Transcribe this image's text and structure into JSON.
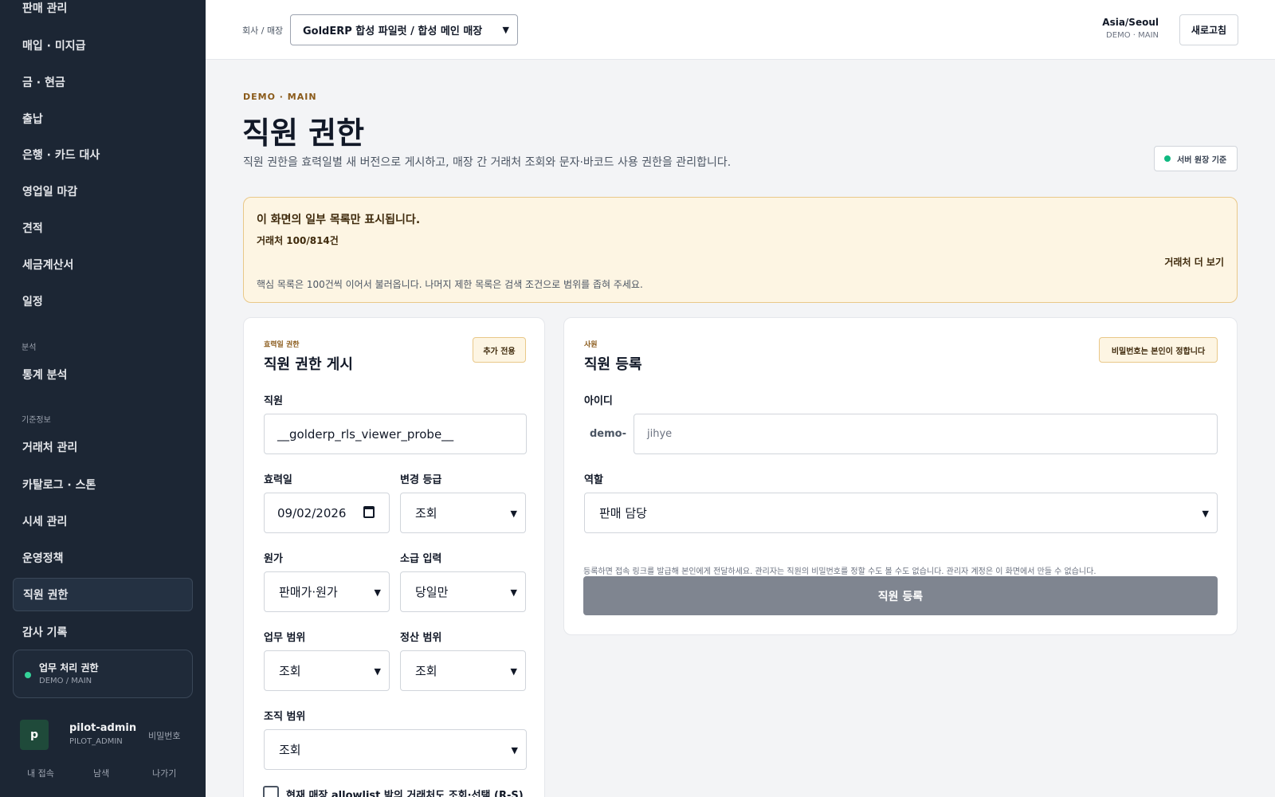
{
  "sidebar": {
    "items": [
      {
        "label": "판매 관리"
      },
      {
        "label": "매입 · 미지급"
      },
      {
        "label": "금 · 현금"
      },
      {
        "label": "출납"
      },
      {
        "label": "은행 · 카드 대사"
      },
      {
        "label": "영업일 마감"
      },
      {
        "label": "견적"
      },
      {
        "label": "세금계산서"
      },
      {
        "label": "일정"
      },
      {
        "label": "통계 분석"
      },
      {
        "label": "거래처 관리"
      },
      {
        "label": "카탈로그 · 스톤"
      },
      {
        "label": "시세 관리"
      },
      {
        "label": "운영정책"
      },
      {
        "label": "직원 권한"
      },
      {
        "label": "감사 기록"
      }
    ],
    "sections": {
      "analysis": "분석",
      "master": "기준정보"
    },
    "permission_card": {
      "title": "업무 처리 권한",
      "sub": "DEMO / MAIN"
    },
    "user": {
      "initial": "p",
      "name": "pilot-admin",
      "role": "PILOT_ADMIN",
      "password_link": "비밀번호"
    },
    "footer": {
      "my_access": "내 접속",
      "theme": "남색",
      "logout": "나가기"
    }
  },
  "header": {
    "company_label": "회사 / 매장",
    "company_value": "GoldERP 합성 파일럿 / 합성 메인 매장",
    "timezone": "Asia/Seoul",
    "tenant": "DEMO · MAIN",
    "refresh": "새로고침"
  },
  "page": {
    "eyebrow": "DEMO · MAIN",
    "title": "직원 권한",
    "description": "직원 권한을 효력일별 새 버전으로 게시하고, 매장 간 거래처 조회와 문자·바코드 사용 권한을 관리합니다.",
    "policy_badge": "서버 원장 기준"
  },
  "notice": {
    "title": "이 화면의 일부 목록만 표시됩니다.",
    "count": "거래처 100/814건",
    "more": "거래처 더 보기",
    "body": "핵심 목록은 100건씩 이어서 불러옵니다. 나머지 제한 목록은 검색 조건으로 범위를 좁혀 주세요."
  },
  "permission_form": {
    "eyebrow": "효력일 권한",
    "title": "직원 권한 게시",
    "badge": "추가 전용",
    "employee_label": "직원",
    "employee_value": "__golderp_rls_viewer_probe__",
    "effective_label": "효력일",
    "effective_value": "09/02/2026",
    "change_grade_label": "변경 등급",
    "change_grade_value": "조회",
    "cost_label": "원가",
    "cost_value": "판매가·원가",
    "backdate_label": "소급 입력",
    "backdate_value": "당일만",
    "work_scope_label": "업무 범위",
    "work_scope_value": "조회",
    "settle_scope_label": "정산 범위",
    "settle_scope_value": "조회",
    "org_scope_label": "조직 범위",
    "org_scope_value": "조회",
    "allowlist_label": "현재 매장 allowlist 밖의 거래처도 조회·선택 (R-S)"
  },
  "register_form": {
    "eyebrow": "사원",
    "title": "직원 등록",
    "badge": "비밀번호는 본인이 정합니다",
    "id_label": "아이디",
    "id_prefix": "demo-",
    "id_placeholder": "jihye",
    "role_label": "역할",
    "role_value": "판매 담당",
    "help": "등록하면 접속 링크를 발급해 본인에게 전달하세요. 관리자는 직원의 비밀번호를 정할 수도 볼 수도 없습니다. 관리자 계정은 이 화면에서 만들 수 없습니다.",
    "submit": "직원 등록"
  }
}
